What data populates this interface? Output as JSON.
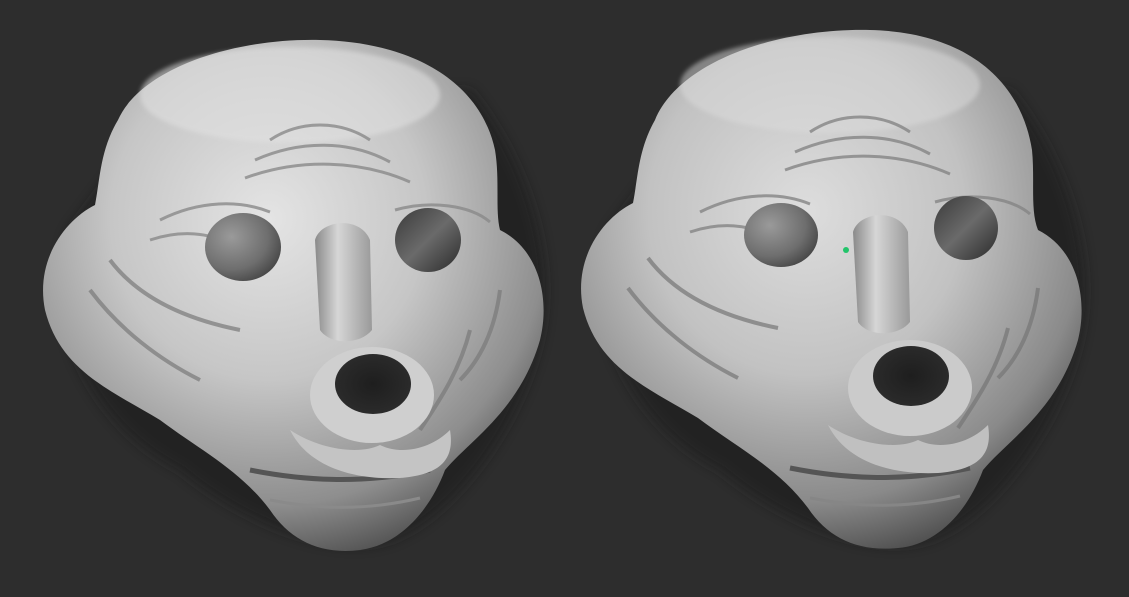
{
  "scene": {
    "background_color": "#2d2d2d",
    "model_color": "#c9c9c9",
    "marker_color": "#22c46a",
    "views": [
      {
        "id": "left",
        "description_name": "mask-render-left"
      },
      {
        "id": "right",
        "description_name": "mask-render-right"
      }
    ]
  }
}
